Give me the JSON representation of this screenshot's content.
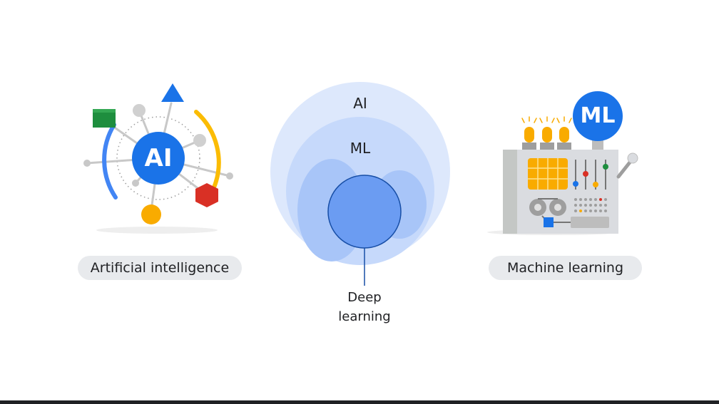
{
  "left": {
    "badge": "AI",
    "caption": "Artificial intelligence",
    "icon": "ai-network-icon"
  },
  "center": {
    "outer_label": "AI",
    "middle_label": "ML",
    "inner_label_line1": "Deep",
    "inner_label_line2": "learning"
  },
  "right": {
    "badge": "ML",
    "caption": "Machine learning",
    "icon": "ml-machine-icon"
  },
  "colors": {
    "google_blue": "#1a73e8",
    "google_red": "#d93025",
    "google_yellow": "#f9ab00",
    "google_green": "#1e8e3e",
    "pill_bg": "#e8eaed"
  }
}
